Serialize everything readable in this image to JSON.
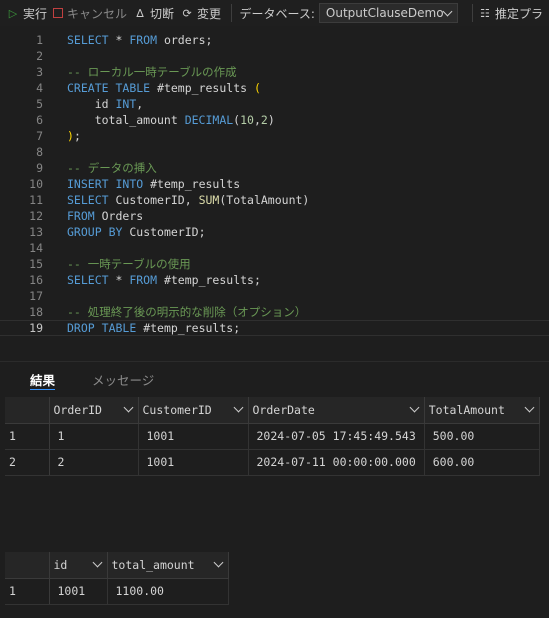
{
  "toolbar": {
    "run_label": "実行",
    "cancel_label": "キャンセル",
    "disconnect_label": "切断",
    "change_label": "変更",
    "db_label": "データベース:",
    "db_value": "OutputClauseDemo",
    "plan_label": "推定プラ"
  },
  "editor": {
    "lines": [
      {
        "n": "1",
        "tokens": [
          {
            "t": "SELECT",
            "c": "k"
          },
          {
            "t": " * ",
            "c": "p"
          },
          {
            "t": "FROM",
            "c": "k"
          },
          {
            "t": " orders;",
            "c": "i"
          }
        ]
      },
      {
        "n": "2",
        "tokens": []
      },
      {
        "n": "3",
        "tokens": [
          {
            "t": "-- ローカル一時テーブルの作成",
            "c": "c"
          }
        ]
      },
      {
        "n": "4",
        "tokens": [
          {
            "t": "CREATE",
            "c": "k"
          },
          {
            "t": " ",
            "c": "p"
          },
          {
            "t": "TABLE",
            "c": "k"
          },
          {
            "t": " #temp_results ",
            "c": "i"
          },
          {
            "t": "(",
            "c": "y"
          }
        ]
      },
      {
        "n": "5",
        "tokens": [
          {
            "t": "    id ",
            "c": "i"
          },
          {
            "t": "INT",
            "c": "k"
          },
          {
            "t": ",",
            "c": "p"
          }
        ]
      },
      {
        "n": "6",
        "tokens": [
          {
            "t": "    total_amount ",
            "c": "i"
          },
          {
            "t": "DECIMAL",
            "c": "k"
          },
          {
            "t": "(",
            "c": "p"
          },
          {
            "t": "10",
            "c": "n"
          },
          {
            "t": ",",
            "c": "p"
          },
          {
            "t": "2",
            "c": "n"
          },
          {
            "t": ")",
            "c": "p"
          }
        ]
      },
      {
        "n": "7",
        "tokens": [
          {
            "t": ")",
            "c": "y"
          },
          {
            "t": ";",
            "c": "p"
          }
        ]
      },
      {
        "n": "8",
        "tokens": []
      },
      {
        "n": "9",
        "tokens": [
          {
            "t": "-- データの挿入",
            "c": "c"
          }
        ]
      },
      {
        "n": "10",
        "tokens": [
          {
            "t": "INSERT",
            "c": "k"
          },
          {
            "t": " ",
            "c": "p"
          },
          {
            "t": "INTO",
            "c": "k"
          },
          {
            "t": " #temp_results",
            "c": "i"
          }
        ]
      },
      {
        "n": "11",
        "tokens": [
          {
            "t": "SELECT",
            "c": "k"
          },
          {
            "t": " CustomerID, ",
            "c": "i"
          },
          {
            "t": "SUM",
            "c": "f"
          },
          {
            "t": "(TotalAmount)",
            "c": "i"
          }
        ]
      },
      {
        "n": "12",
        "tokens": [
          {
            "t": "FROM",
            "c": "k"
          },
          {
            "t": " Orders",
            "c": "i"
          }
        ]
      },
      {
        "n": "13",
        "tokens": [
          {
            "t": "GROUP",
            "c": "k"
          },
          {
            "t": " ",
            "c": "p"
          },
          {
            "t": "BY",
            "c": "k"
          },
          {
            "t": " CustomerID;",
            "c": "i"
          }
        ]
      },
      {
        "n": "14",
        "tokens": []
      },
      {
        "n": "15",
        "tokens": [
          {
            "t": "-- 一時テーブルの使用",
            "c": "c"
          }
        ]
      },
      {
        "n": "16",
        "tokens": [
          {
            "t": "SELECT",
            "c": "k"
          },
          {
            "t": " * ",
            "c": "p"
          },
          {
            "t": "FROM",
            "c": "k"
          },
          {
            "t": " #temp_results;",
            "c": "i"
          }
        ]
      },
      {
        "n": "17",
        "tokens": []
      },
      {
        "n": "18",
        "tokens": [
          {
            "t": "-- 処理終了後の明示的な削除（オプション）",
            "c": "c"
          }
        ]
      },
      {
        "n": "19",
        "tokens": [
          {
            "t": "DROP",
            "c": "k"
          },
          {
            "t": " ",
            "c": "p"
          },
          {
            "t": "TABLE",
            "c": "k"
          },
          {
            "t": " #temp_results;",
            "c": "i"
          }
        ]
      }
    ]
  },
  "results": {
    "tab_results": "結果",
    "tab_messages": "メッセージ",
    "grid1": {
      "columns": [
        "OrderID",
        "CustomerID",
        "OrderDate",
        "TotalAmount"
      ],
      "rows": [
        {
          "rn": "1",
          "cells": [
            "1",
            "1001",
            "2024-07-05 17:45:49.543",
            "500.00"
          ]
        },
        {
          "rn": "2",
          "cells": [
            "2",
            "1001",
            "2024-07-11 00:00:00.000",
            "600.00"
          ]
        }
      ]
    },
    "grid2": {
      "columns": [
        "id",
        "total_amount"
      ],
      "rows": [
        {
          "rn": "1",
          "cells": [
            "1001",
            "1100.00"
          ]
        }
      ]
    }
  }
}
